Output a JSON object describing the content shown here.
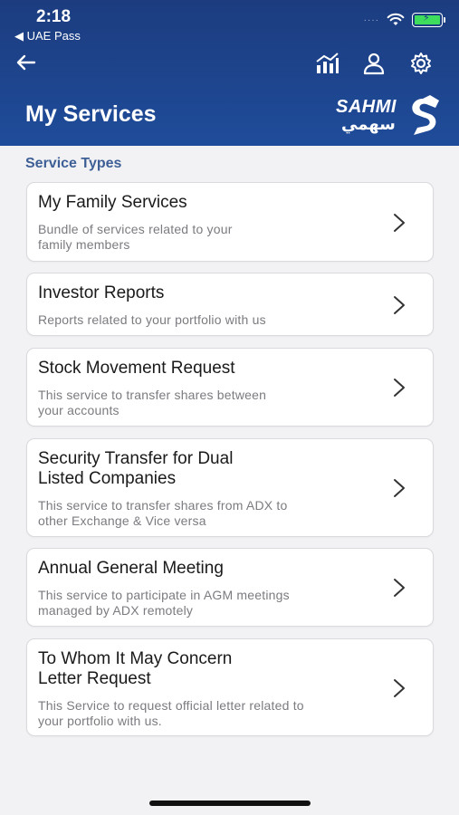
{
  "status_bar": {
    "time": "2:18",
    "back_app": "◀ UAE Pass",
    "signal": "····",
    "battery_color": "#3ddc5c"
  },
  "header": {
    "title": "My Services",
    "background": "#1f4c9a",
    "icons": [
      "back-arrow-icon",
      "chart-icon",
      "profile-icon",
      "settings-gear-icon"
    ],
    "logo_text": "SAHMI",
    "logo_arabic": "سهمي"
  },
  "main": {
    "section_title": "Service Types",
    "cards": [
      {
        "title": "My Family Services",
        "desc_line1": "Bundle of services related to your",
        "desc_line2": "family members"
      },
      {
        "title": "Investor Reports",
        "desc_line1": "Reports related to your portfolio with us",
        "desc_line2": ""
      },
      {
        "title": "Stock Movement Request",
        "desc_line1": "This service to transfer shares between",
        "desc_line2": "your accounts"
      },
      {
        "title_line1": "Security Transfer for Dual",
        "title_line2": "Listed Companies",
        "desc_line1": "This service to transfer shares from ADX to",
        "desc_line2": "other Exchange & Vice versa"
      },
      {
        "title": "Annual General Meeting",
        "desc_line1": "This service to participate in AGM meetings",
        "desc_line2": "managed by ADX remotely"
      },
      {
        "title_line1": "To Whom It May Concern",
        "title_line2": "Letter Request",
        "desc_line1": "This Service to request official letter related to",
        "desc_line2": "your portfolio with us."
      }
    ]
  }
}
